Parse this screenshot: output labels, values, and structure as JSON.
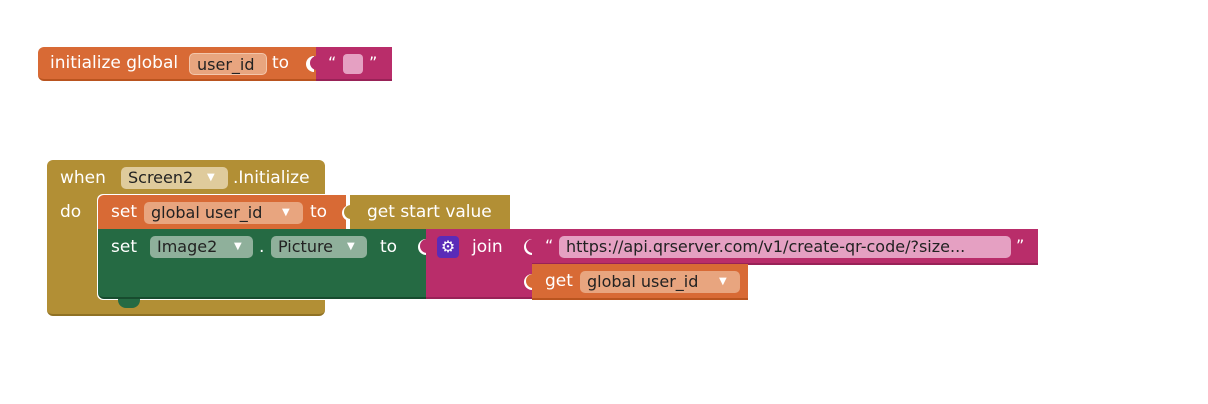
{
  "colors": {
    "variables": "#d86a35",
    "variables_dark": "#b9541f",
    "variables_field": "#e8a57f",
    "text": "#b92d6a",
    "text_dark": "#982257",
    "text_field": "#e5a0c2",
    "control": "#b28f35",
    "control_field": "#dfcb9c",
    "component": "#256a43",
    "component_field": "#8fb09b",
    "get_start": "#b28f35",
    "gear_bg": "#5a2bb8"
  },
  "icons": {
    "mutator": "gear-icon",
    "dropdown": "dropdown-arrow-icon"
  },
  "global_block": {
    "keyword": "initialize global",
    "var_name": "user_id",
    "to_label": "to",
    "quote_open": "“",
    "quote_close": "”"
  },
  "event_block": {
    "when_label": "when",
    "component": "Screen2",
    "event": ".Initialize",
    "do_label": "do",
    "stmt1": {
      "set_label": "set",
      "var": "global user_id",
      "to_label": "to",
      "value": "get start value"
    },
    "stmt2": {
      "set_label": "set",
      "component": "Image2",
      "dot": ".",
      "property": "Picture",
      "to_label": "to",
      "join_label": "join",
      "quote_open": "“",
      "url": "https://api.qrserver.com/v1/create-qr-code/?size...",
      "quote_close": "”",
      "get_label": "get",
      "get_var": "global user_id"
    }
  }
}
